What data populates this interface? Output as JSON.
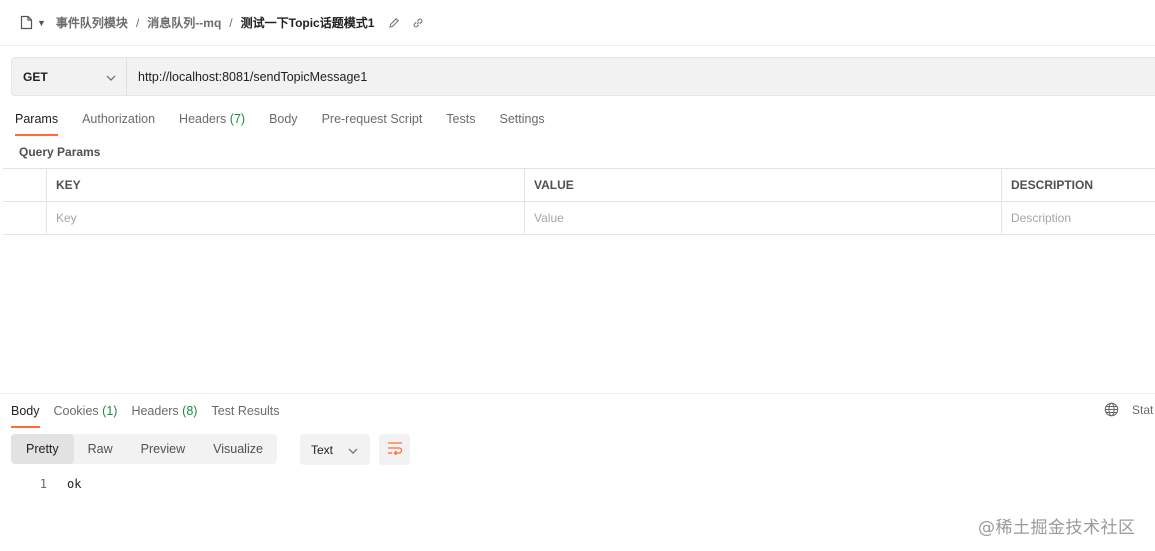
{
  "breadcrumb": {
    "items": [
      "事件队列模块",
      "消息队列--mq"
    ],
    "separator": "/",
    "current": "测试一下Topic话题模式1"
  },
  "request": {
    "method": "GET",
    "url": "http://localhost:8081/sendTopicMessage1"
  },
  "request_tabs": [
    {
      "label": "Params",
      "count": ""
    },
    {
      "label": "Authorization",
      "count": ""
    },
    {
      "label": "Headers",
      "count": "(7)"
    },
    {
      "label": "Body",
      "count": ""
    },
    {
      "label": "Pre-request Script",
      "count": ""
    },
    {
      "label": "Tests",
      "count": ""
    },
    {
      "label": "Settings",
      "count": ""
    }
  ],
  "query_params": {
    "title": "Query Params",
    "headers": [
      "KEY",
      "VALUE",
      "DESCRIPTION"
    ],
    "placeholders": {
      "key": "Key",
      "value": "Value",
      "description": "Description"
    }
  },
  "response": {
    "tabs": [
      {
        "label": "Body",
        "count": ""
      },
      {
        "label": "Cookies",
        "count": "(1)"
      },
      {
        "label": "Headers",
        "count": "(8)"
      },
      {
        "label": "Test Results",
        "count": ""
      }
    ],
    "status_label": "Stat",
    "view_modes": [
      "Pretty",
      "Raw",
      "Preview",
      "Visualize"
    ],
    "format": "Text",
    "lines": [
      {
        "num": "1",
        "text": "ok"
      }
    ]
  },
  "watermark": "@稀土掘金技术社区",
  "colors": {
    "accent": "#ff6c37",
    "count": "#1d8a45"
  }
}
